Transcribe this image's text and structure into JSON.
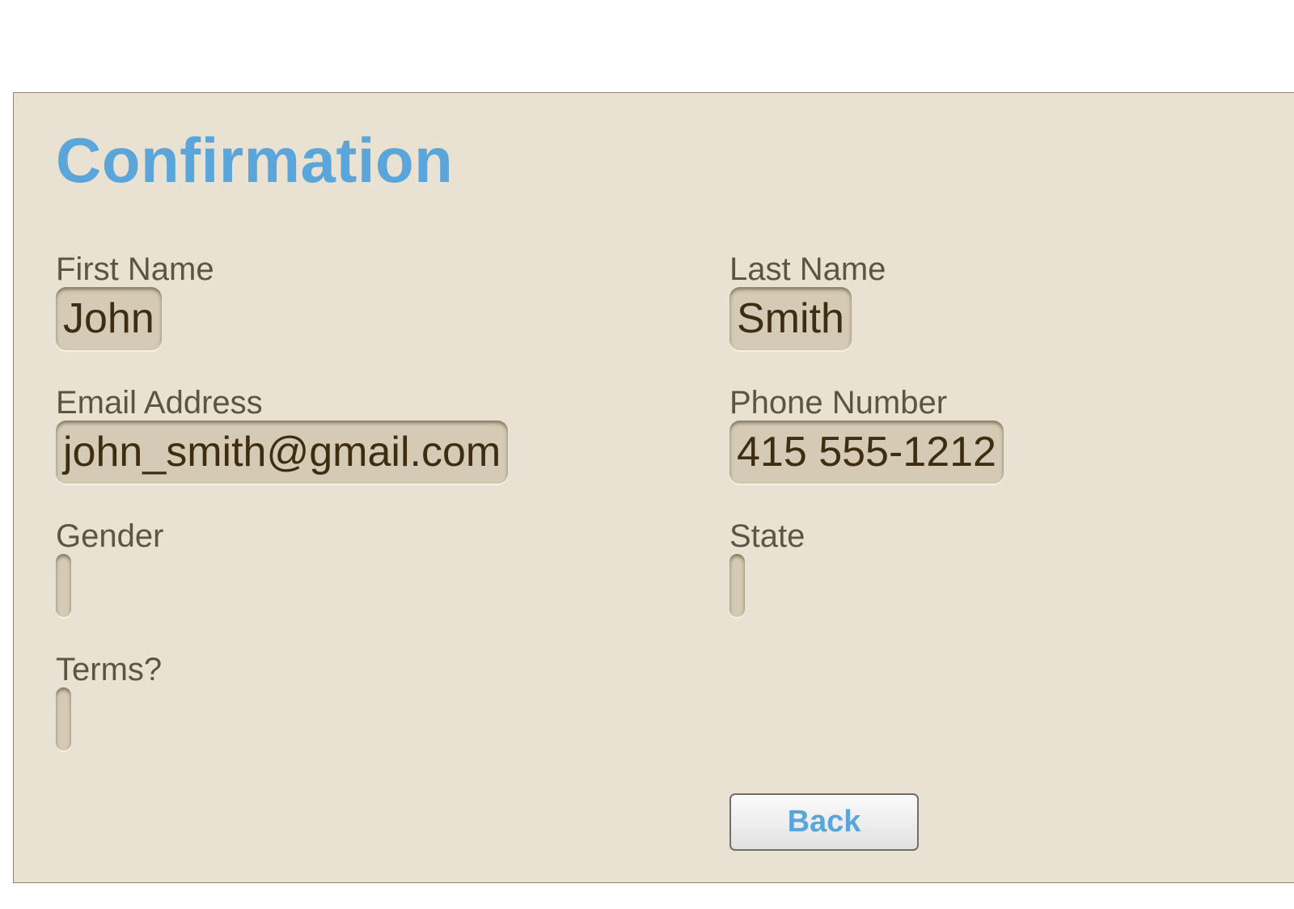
{
  "form": {
    "title": "Confirmation",
    "fields": {
      "first_name": {
        "label": "First Name",
        "value": "John"
      },
      "last_name": {
        "label": "Last Name",
        "value": "Smith"
      },
      "email": {
        "label": "Email Address",
        "value": "john_smith@gmail.com"
      },
      "phone": {
        "label": "Phone Number",
        "value": "415 555-1212"
      },
      "gender": {
        "label": "Gender",
        "value": ""
      },
      "state": {
        "label": "State",
        "value": ""
      },
      "terms": {
        "label": "Terms?",
        "value": ""
      }
    },
    "back_label": "Back"
  },
  "colors": {
    "title": "#5aa5da",
    "panel_background": "#e9e2d2",
    "label_text": "#5d5444",
    "value_text": "#3e2d10",
    "value_background": "#d4cab5"
  }
}
